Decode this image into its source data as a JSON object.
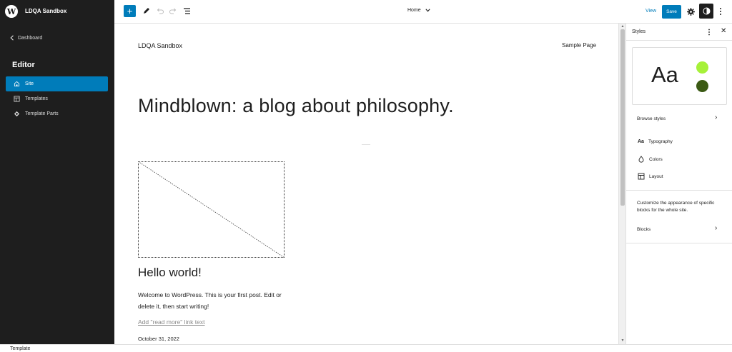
{
  "sidebar": {
    "site_name": "LDQA Sandbox",
    "dashboard_label": "Dashboard",
    "editor_title": "Editor",
    "items": [
      {
        "label": "Site",
        "icon": "home-icon",
        "active": true
      },
      {
        "label": "Templates",
        "icon": "layout-icon",
        "active": false
      },
      {
        "label": "Template Parts",
        "icon": "diamond-icon",
        "active": false
      }
    ]
  },
  "toolbar": {
    "template_label": "Home",
    "view_label": "View",
    "save_label": "Save"
  },
  "canvas": {
    "site_title": "LDQA Sandbox",
    "nav_link": "Sample Page",
    "heading": "Mindblown: a blog about philosophy.",
    "post_title": "Hello world!",
    "excerpt": "Welcome to WordPress. This is your first post. Edit or delete it, then start writing!",
    "read_more": "Add \"read more\" link text",
    "date": "October 31, 2022"
  },
  "styles_panel": {
    "title": "Styles",
    "preview_text": "Aa",
    "preview_colors": [
      "#a6f139",
      "#3b5a14"
    ],
    "browse_label": "Browse styles",
    "items": [
      {
        "label": "Typography",
        "icon": "typography-icon"
      },
      {
        "label": "Colors",
        "icon": "droplet-icon"
      },
      {
        "label": "Layout",
        "icon": "layout-icon"
      }
    ],
    "description": "Customize the appearance of specific blocks for the whole site.",
    "blocks_label": "Blocks"
  },
  "footer": {
    "label": "Template"
  },
  "colors": {
    "accent": "#007cba",
    "sidebar_bg": "#1e1e1e"
  }
}
